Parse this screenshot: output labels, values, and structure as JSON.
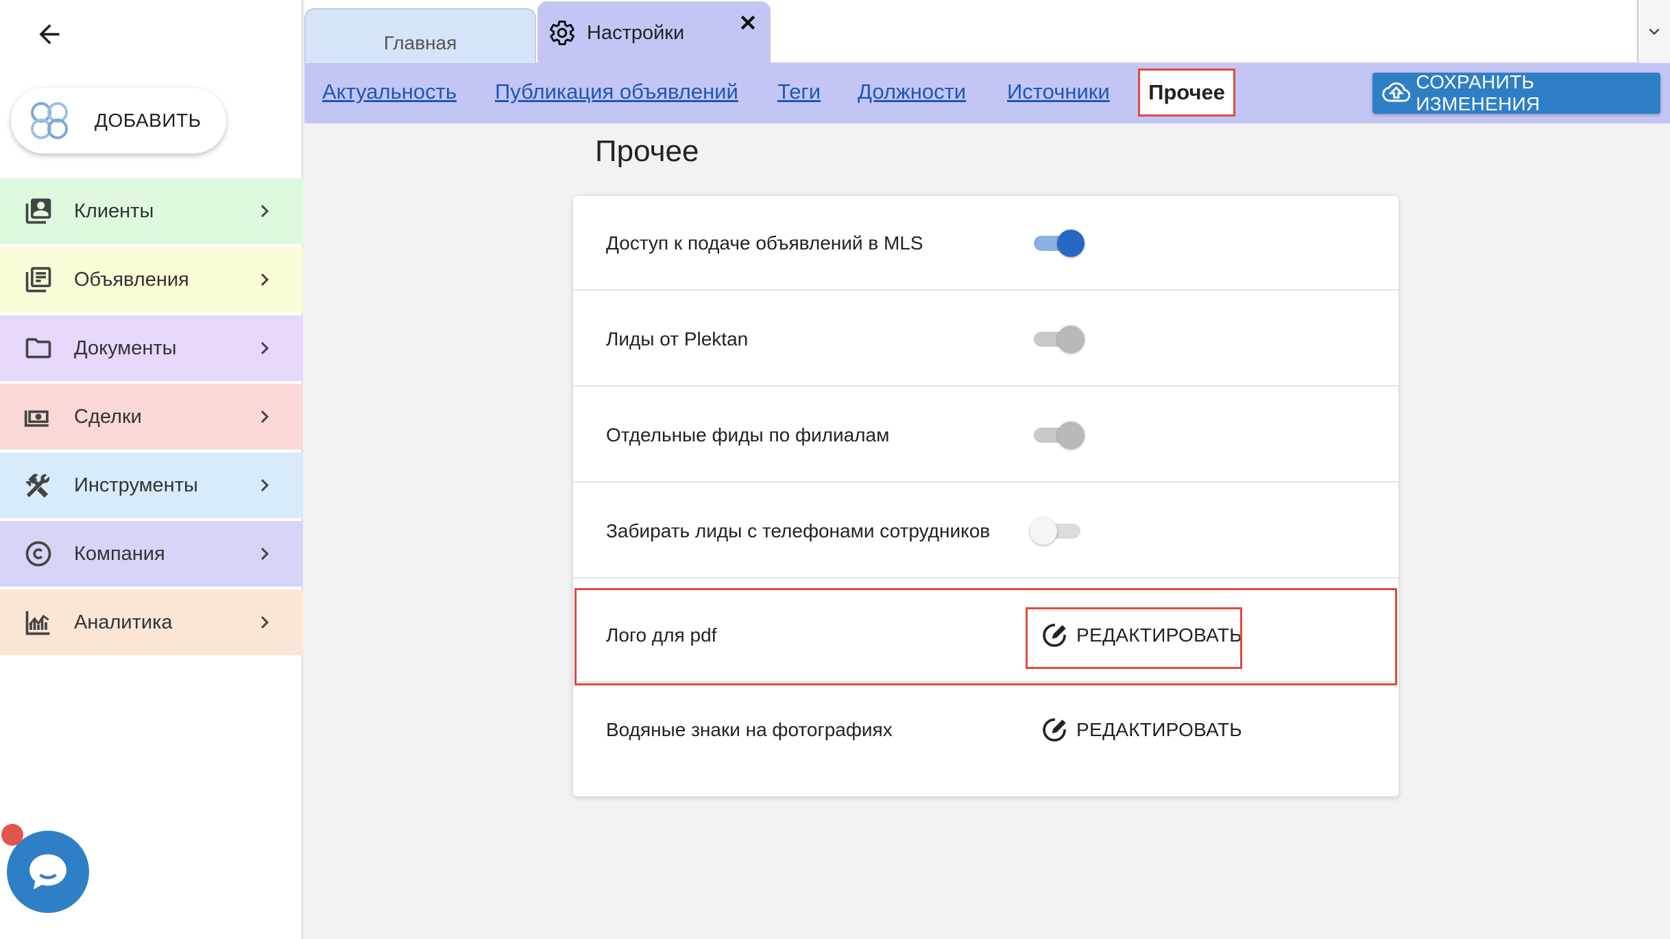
{
  "sidebar": {
    "add_label": "ДОБАВИТЬ",
    "items": [
      {
        "label": "Клиенты",
        "icon": "contacts-icon",
        "color": "#dff9df"
      },
      {
        "label": "Объявления",
        "icon": "listings-icon",
        "color": "#fbfdd8"
      },
      {
        "label": "Документы",
        "icon": "folder-icon",
        "color": "#e6d8fb"
      },
      {
        "label": "Сделки",
        "icon": "money-icon",
        "color": "#fbd8d8"
      },
      {
        "label": "Инструменты",
        "icon": "tools-icon",
        "color": "#d8ebfb"
      },
      {
        "label": "Компания",
        "icon": "copyright-icon",
        "color": "#d6d4f7"
      },
      {
        "label": "Аналитика",
        "icon": "analytics-icon",
        "color": "#fbe6d6"
      }
    ]
  },
  "tabs": {
    "home_label": "Главная",
    "settings_label": "Настройки"
  },
  "subnav": {
    "links": [
      "Актуальность",
      "Публикация объявлений",
      "Теги",
      "Должности",
      "Источники"
    ],
    "active": "Прочее",
    "save_label": "СОХРАНИТЬ ИЗМЕНЕНИЯ"
  },
  "main": {
    "title": "Прочее",
    "rows": [
      {
        "label": "Доступ к подаче объявлений в MLS",
        "type": "toggle",
        "state": "on"
      },
      {
        "label": "Лиды от Plektan",
        "type": "toggle",
        "state": "disabled-on"
      },
      {
        "label": "Отдельные фиды по филиалам",
        "type": "toggle",
        "state": "disabled-on"
      },
      {
        "label": "Забирать лиды с телефонами сотрудников",
        "type": "toggle",
        "state": "off"
      },
      {
        "label": "Лого для pdf",
        "type": "edit",
        "action": "РЕДАКТИРОВАТЬ"
      },
      {
        "label": "Водяные знаки на фотографиях",
        "type": "edit",
        "action": "РЕДАКТИРОВАТЬ"
      }
    ]
  },
  "colors": {
    "accent": "#2f7fc7",
    "subnav_bg": "#c3c6f5",
    "highlight": "#e04a3d"
  }
}
